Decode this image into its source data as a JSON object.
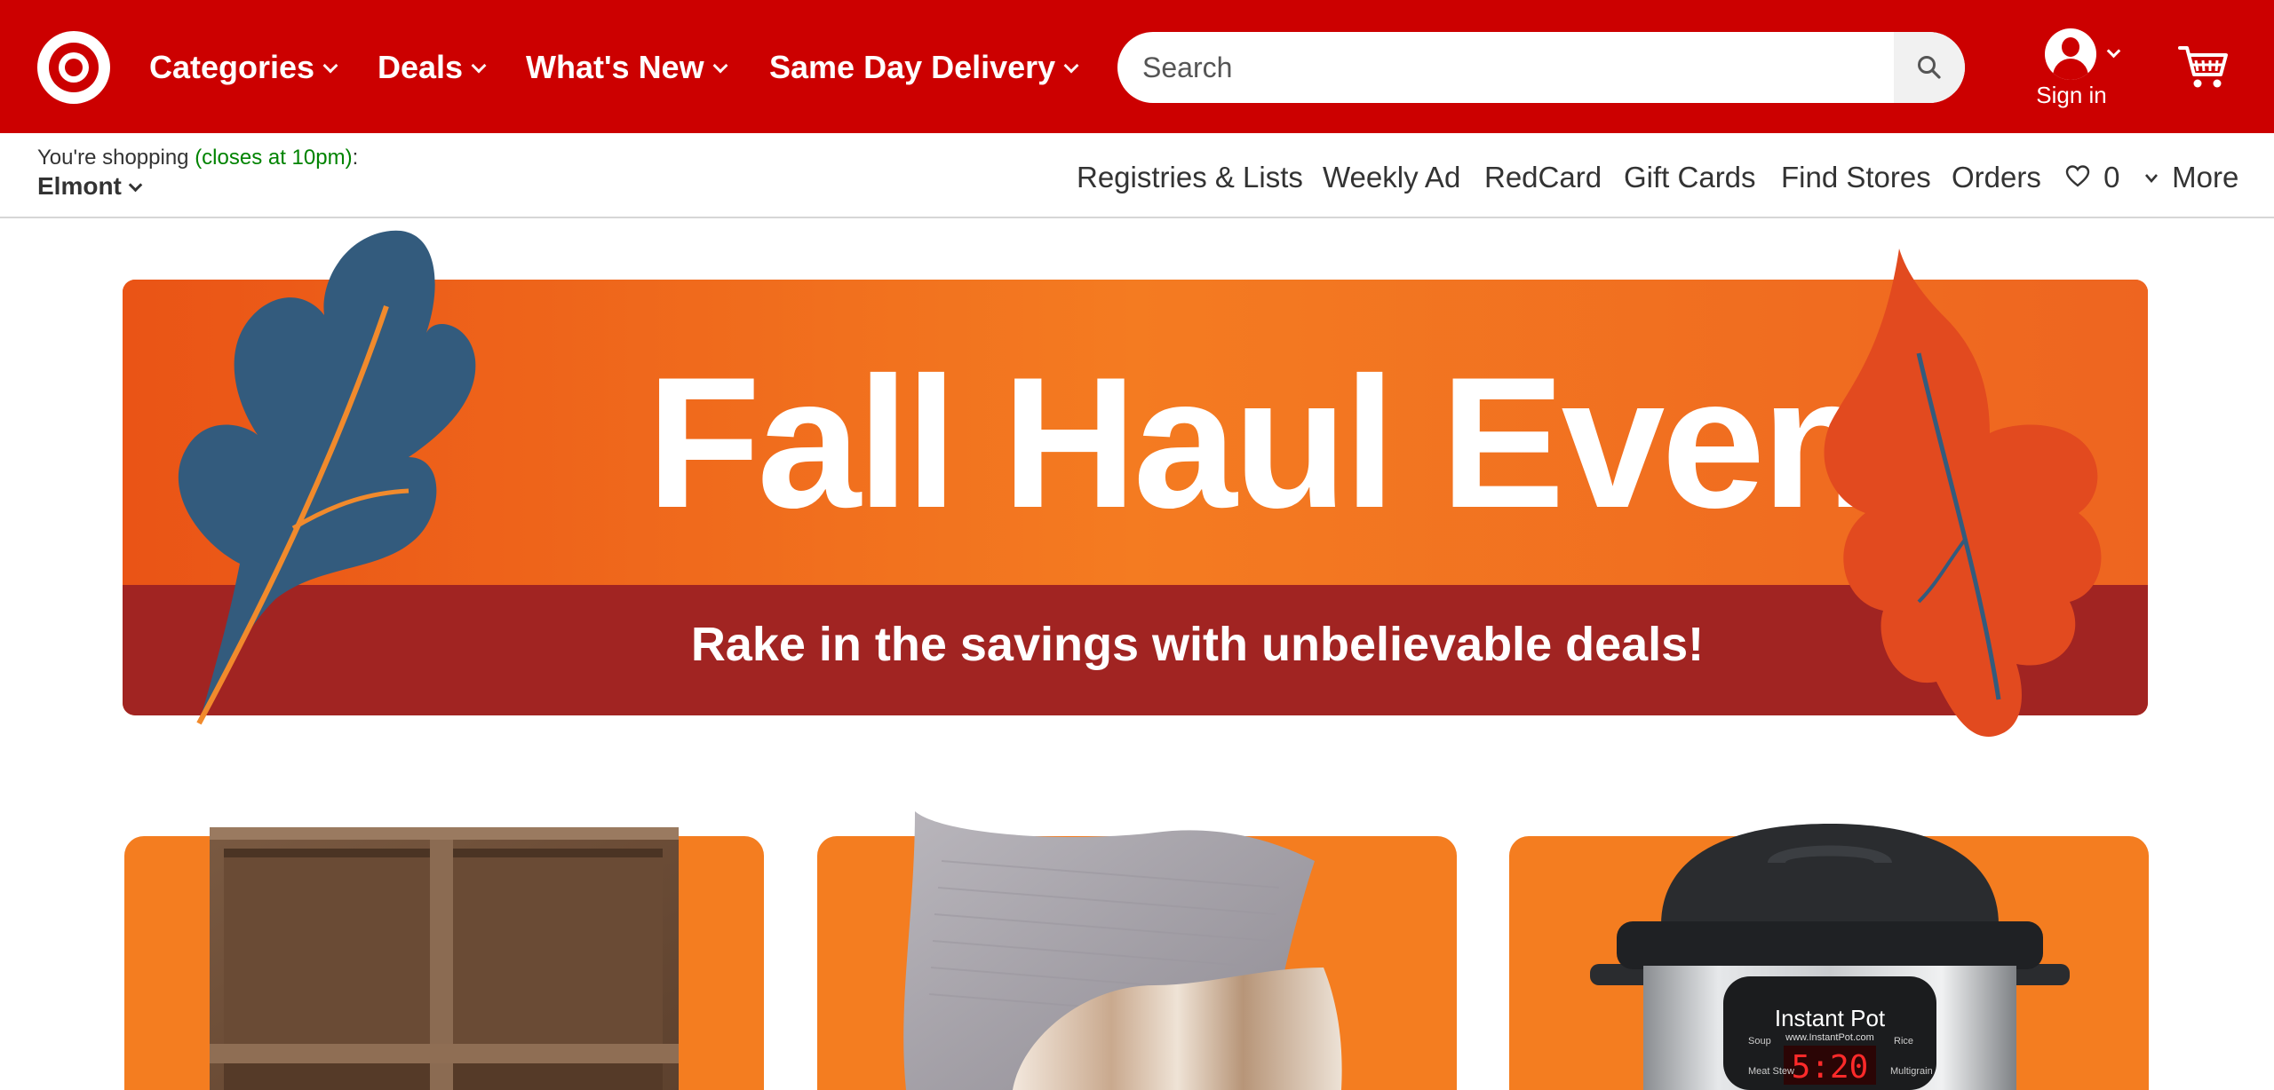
{
  "header": {
    "nav": [
      {
        "label": "Categories"
      },
      {
        "label": "Deals"
      },
      {
        "label": "What's New"
      },
      {
        "label": "Same Day Delivery"
      }
    ],
    "search": {
      "placeholder": "Search"
    },
    "account": {
      "label": "Sign in"
    }
  },
  "subbar": {
    "shopping_prefix": "You're shopping ",
    "closes": "(closes at 10pm)",
    "suffix": ":",
    "store": "Elmont",
    "links": [
      {
        "label": "Registries & Lists"
      },
      {
        "label": "Weekly Ad"
      },
      {
        "label": "RedCard"
      },
      {
        "label": "Gift Cards"
      },
      {
        "label": "Find Stores"
      },
      {
        "label": "Orders"
      }
    ],
    "favorites_count": "0",
    "more_label": "More"
  },
  "hero": {
    "title": "Fall Haul Event",
    "subtitle": "Rake in the savings with unbelievable deals!"
  },
  "cards": [
    {
      "icon": "cube-shelf-image"
    },
    {
      "icon": "pillow-image"
    },
    {
      "icon": "pressure-cooker-image",
      "brand": "Instant Pot",
      "url": "www.InstantPot.com",
      "display": "5:20",
      "labels": [
        "Soup",
        "Rice",
        "Meat Stew",
        "Multigrain"
      ]
    }
  ],
  "colors": {
    "brand_red": "#cc0000",
    "hero_orange": "#f47b21",
    "hero_band": "#a12422",
    "store_closes_green": "#008300"
  }
}
